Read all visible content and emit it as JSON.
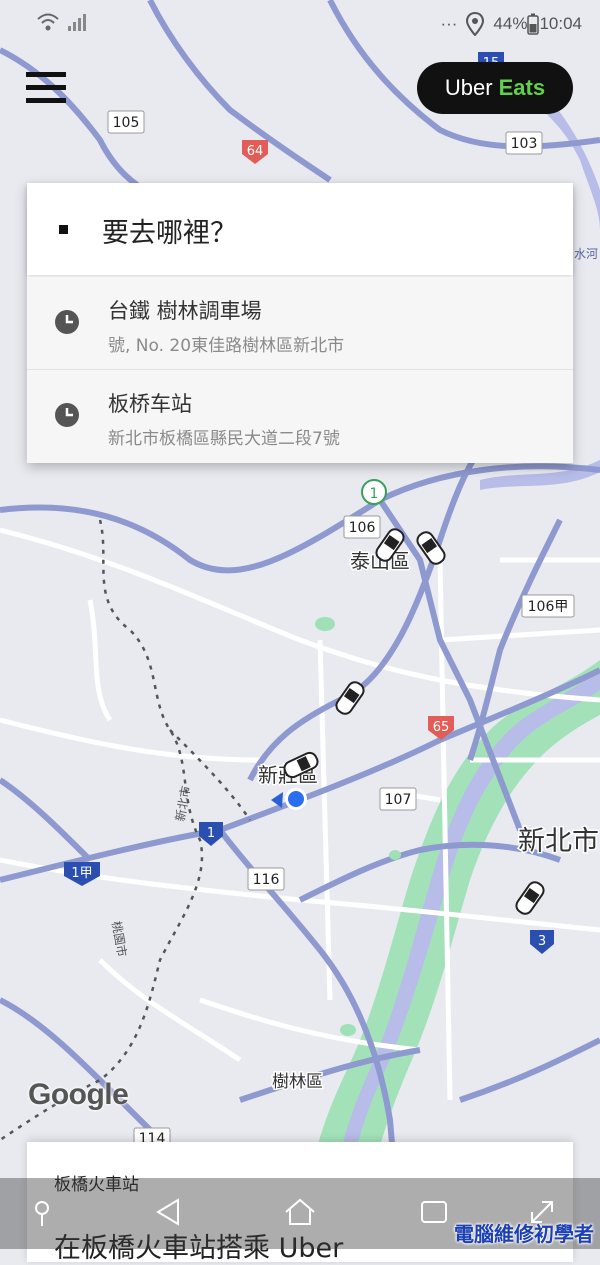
{
  "status_bar": {
    "dots": "···",
    "battery": "44%",
    "time": "10:04"
  },
  "header": {
    "uber_eats_label_1": "Uber",
    "uber_eats_label_2": "Eats"
  },
  "search": {
    "placeholder": "要去哪裡？"
  },
  "recent_places": [
    {
      "title": "台鐵 樹林調車場",
      "subtitle": "號, No. 20東佳路樹林區新北市"
    },
    {
      "title": "板桥车站",
      "subtitle": "新北市板橋區縣民大道二段7號"
    }
  ],
  "map_labels": {
    "road_105": "105",
    "road_64": "64",
    "road_103": "103",
    "road_15": "15",
    "road_106": "106",
    "road_106a": "106甲",
    "road_65": "65",
    "road_107": "107",
    "road_116": "116",
    "road_1": "1",
    "road_1a": "1甲",
    "road_3": "3",
    "road_114": "114",
    "district_taishan": "泰山區",
    "district_xinzhuang": "新莊區",
    "district_shulin": "樹林區",
    "city_xinbei": "新北市",
    "boundary_xinbei": "新北市",
    "boundary_taoyuan": "桃園市",
    "river": "水河",
    "road_label_right": "淡水河",
    "google": "Google"
  },
  "bottom_card": {
    "label": "板橋火車站",
    "title": "在板橋火車站搭乘 Uber"
  },
  "watermark": "電腦維修初學者",
  "colors": {
    "map_bg": "#e8eaf0",
    "road_major": "#8e99cf",
    "road_minor": "#ffffff",
    "river": "#b2b8e6",
    "green": "#9fe0b6",
    "uber_eats_green": "#62d04b"
  }
}
